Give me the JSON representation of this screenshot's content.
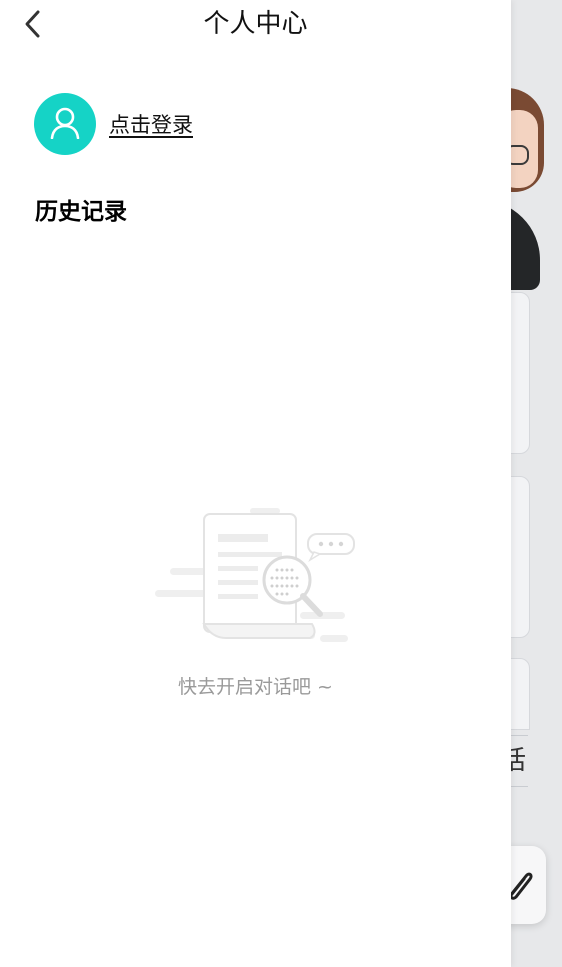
{
  "header": {
    "title": "个人中心"
  },
  "user": {
    "login_label": "点击登录"
  },
  "history": {
    "title": "历史记录",
    "empty_text": "快去开启对话吧 ~"
  },
  "background": {
    "partial_label": "话"
  },
  "colors": {
    "avatar_bg": "#15d3c6",
    "drawer_bg": "#ffffff",
    "empty_text": "#9a9a9a",
    "backdrop": "#e7e8ea"
  },
  "icons": {
    "back": "chevron-left-icon",
    "avatar": "user-icon",
    "empty": "empty-search-document-illustration",
    "attach": "paperclip-icon"
  }
}
